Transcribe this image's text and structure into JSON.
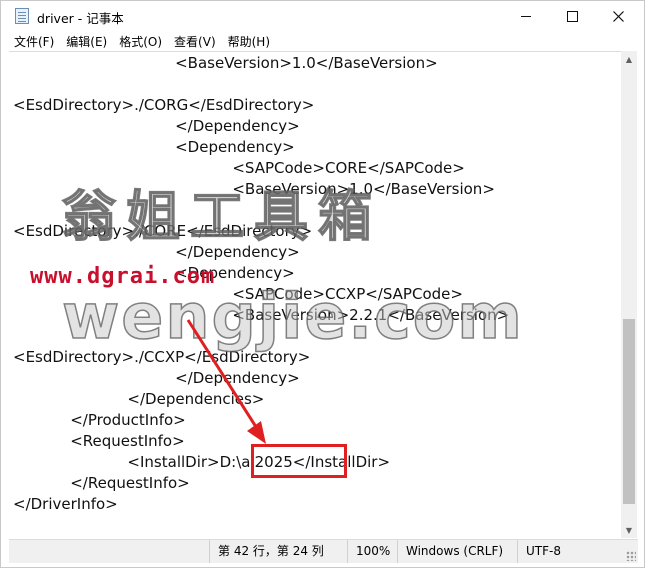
{
  "window": {
    "title": "driver - 记事本"
  },
  "menu": [
    "文件(F)",
    "编辑(E)",
    "格式(O)",
    "查看(V)",
    "帮助(H)"
  ],
  "editor": {
    "lines": [
      "                                  <BaseVersion>1.0</BaseVersion>",
      "",
      "<EsdDirectory>./CORG</EsdDirectory>",
      "                                  </Dependency>",
      "                                  <Dependency>",
      "                                              <SAPCode>CORE</SAPCode>",
      "                                              <BaseVersion>1.0</BaseVersion>",
      "",
      "<EsdDirectory>./CORE</EsdDirectory>",
      "                                  </Dependency>",
      "                                  <Dependency>",
      "                                              <SAPCode>CCXP</SAPCode>",
      "                                              <BaseVersion>2.2.1</BaseVersion>",
      "",
      "<EsdDirectory>./CCXP</EsdDirectory>",
      "                                  </Dependency>",
      "                        </Dependencies>",
      "            </ProductInfo>",
      "            <RequestInfo>",
      "                        <InstallDir>D:\\ai2025</InstallDir>",
      "            </RequestInfo>",
      "</DriverInfo>"
    ]
  },
  "statusbar": {
    "position": "第 42 行，第 24 列",
    "zoom": "100%",
    "line_ending": "Windows (CRLF)",
    "encoding": "UTF-8"
  },
  "watermark": {
    "chinese": "翁姐工具箱",
    "url": "www.dgrai.com",
    "latin": "wengjie.com"
  },
  "colors": {
    "highlight": "#e02020",
    "url": "#c8102e"
  }
}
